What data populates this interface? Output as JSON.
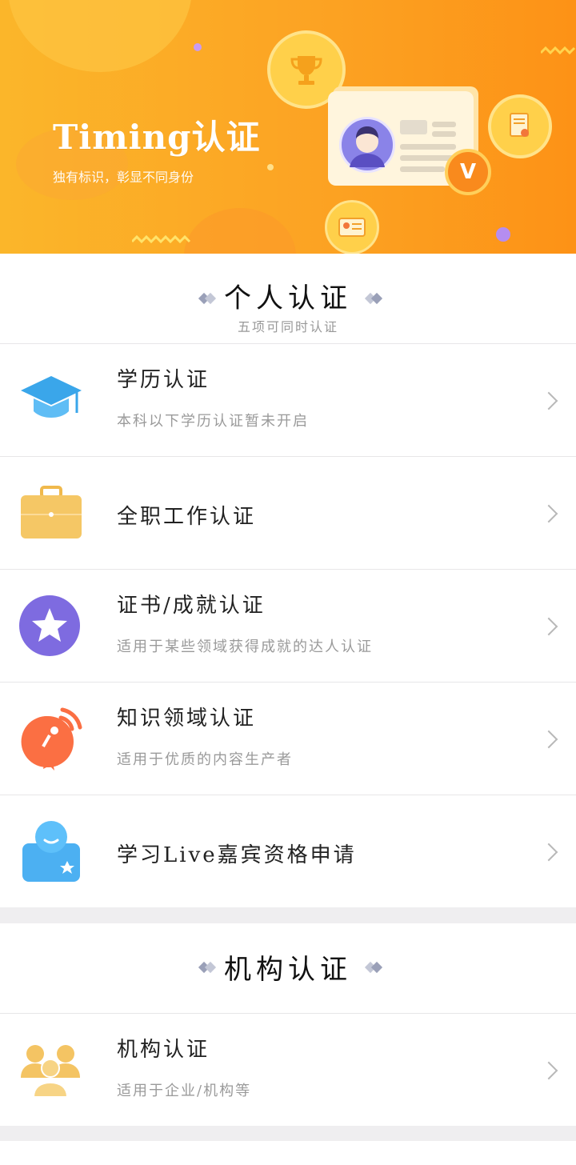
{
  "banner": {
    "title": "Timing认证",
    "subtitle": "独有标识，彰显不同身份"
  },
  "personal": {
    "title": "个人认证",
    "subtitle": "五项可同时认证",
    "items": [
      {
        "icon": "graduation-cap-icon",
        "title": "学历认证",
        "desc": "本科以下学历认证暂未开启"
      },
      {
        "icon": "briefcase-icon",
        "title": "全职工作认证",
        "desc": ""
      },
      {
        "icon": "star-badge-icon",
        "title": "证书/成就认证",
        "desc": "适用于某些领域获得成就的达人认证"
      },
      {
        "icon": "broadcast-bubble-icon",
        "title": "知识领域认证",
        "desc": "适用于优质的内容生产者"
      },
      {
        "icon": "live-guest-icon",
        "title": "学习Live嘉宾资格申请",
        "desc": ""
      }
    ]
  },
  "org": {
    "title": "机构认证",
    "items": [
      {
        "icon": "group-people-icon",
        "title": "机构认证",
        "desc": "适用于企业/机构等"
      }
    ]
  },
  "colors": {
    "banner_start": "#fbb62a",
    "banner_end": "#fd9216",
    "cap_blue": "#3aa6ea",
    "briefcase_gold": "#f5c765",
    "star_purple": "#7e6be0",
    "bubble_orange": "#fb6f43",
    "live_blue": "#4cb0f2",
    "group_gold": "#f4c463"
  }
}
